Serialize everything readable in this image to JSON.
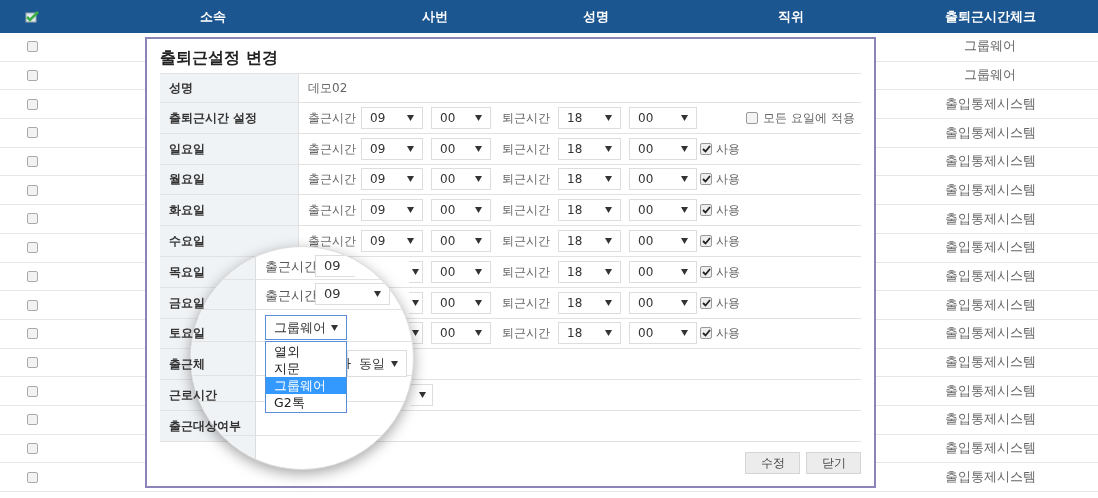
{
  "header": {
    "columns": [
      "소속",
      "사번",
      "성명",
      "직위",
      "출퇴근시간체크"
    ]
  },
  "rows": [
    {
      "checked": false,
      "attendance_check": "그룹웨어"
    },
    {
      "checked": false,
      "attendance_check": "그룹웨어"
    },
    {
      "checked": false,
      "attendance_check": "출입통제시스템"
    },
    {
      "checked": false,
      "attendance_check": "출입통제시스템"
    },
    {
      "checked": false,
      "attendance_check": "출입통제시스템"
    },
    {
      "checked": false,
      "attendance_check": "출입통제시스템"
    },
    {
      "checked": false,
      "attendance_check": "출입통제시스템"
    },
    {
      "checked": false,
      "attendance_check": "출입통제시스템"
    },
    {
      "checked": false,
      "attendance_check": "출입통제시스템"
    },
    {
      "checked": false,
      "attendance_check": "출입통제시스템"
    },
    {
      "checked": false,
      "attendance_check": "출입통제시스템"
    },
    {
      "checked": false,
      "attendance_check": "출입통제시스템"
    },
    {
      "checked": false,
      "attendance_check": "출입통제시스템"
    },
    {
      "checked": false,
      "attendance_check": "출입통제시스템"
    },
    {
      "checked": false,
      "attendance_check": "출입통제시스템"
    },
    {
      "checked": false,
      "attendance_check": "출입통제시스템"
    }
  ],
  "dialog": {
    "title": "출퇴근설정 변경",
    "rows": [
      {
        "kind": "text",
        "label": "성명",
        "value": "데모02"
      },
      {
        "kind": "time",
        "label": "출퇴근시간 설정",
        "start_label": "출근시간",
        "start_hour": "09",
        "start_minute": "00",
        "end_label": "퇴근시간",
        "end_hour": "18",
        "end_minute": "00",
        "apply_all": {
          "label": "모든 요일에 적용",
          "checked": false
        }
      },
      {
        "kind": "time",
        "label": "일요일",
        "start_label": "출근시간",
        "start_hour": "09",
        "start_minute": "00",
        "end_label": "퇴근시간",
        "end_hour": "18",
        "end_minute": "00",
        "use": {
          "label": "사용",
          "checked": true
        }
      },
      {
        "kind": "time",
        "label": "월요일",
        "start_label": "출근시간",
        "start_hour": "09",
        "start_minute": "00",
        "end_label": "퇴근시간",
        "end_hour": "18",
        "end_minute": "00",
        "use": {
          "label": "사용",
          "checked": true
        }
      },
      {
        "kind": "time",
        "label": "화요일",
        "start_label": "출근시간",
        "start_hour": "09",
        "start_minute": "00",
        "end_label": "퇴근시간",
        "end_hour": "18",
        "end_minute": "00",
        "use": {
          "label": "사용",
          "checked": true
        }
      },
      {
        "kind": "time",
        "label": "수요일",
        "start_label": "출근시간",
        "start_hour": "09",
        "start_minute": "00",
        "end_label": "퇴근시간",
        "end_hour": "18",
        "end_minute": "00",
        "use": {
          "label": "사용",
          "checked": true
        }
      },
      {
        "kind": "time",
        "label": "목요일",
        "start_minute": "00",
        "end_label": "퇴근시간",
        "end_hour": "18",
        "end_minute": "00",
        "use": {
          "label": "사용",
          "checked": true
        }
      },
      {
        "kind": "time",
        "label": "금요일",
        "start_minute": "00",
        "end_label": "퇴근시간",
        "end_hour": "18",
        "end_minute": "00",
        "use": {
          "label": "사용",
          "checked": true
        }
      },
      {
        "kind": "time",
        "label": "토요일",
        "start_minute": "00",
        "end_label": "퇴근시간",
        "end_hour": "18",
        "end_minute": "00",
        "use": {
          "label": "사용",
          "checked": true
        }
      },
      {
        "kind": "blank",
        "label": "출근체"
      },
      {
        "kind": "select",
        "label": "근로시간"
      },
      {
        "kind": "blank",
        "label": "출근대상여부"
      }
    ],
    "buttons": [
      "수정",
      "닫기"
    ]
  },
  "magnifier": {
    "start_label_1": "출근시간",
    "start_value_1": "09",
    "start_label_2": "출근시간",
    "start_value_2": "09",
    "select_value": "그룹웨어",
    "options": [
      {
        "label": "열외",
        "selected": false
      },
      {
        "label": "지문",
        "selected": false
      },
      {
        "label": "그룹웨어",
        "selected": true
      },
      {
        "label": "G2톡",
        "selected": false
      }
    ],
    "other_select_value": "ㅏ 동일"
  }
}
